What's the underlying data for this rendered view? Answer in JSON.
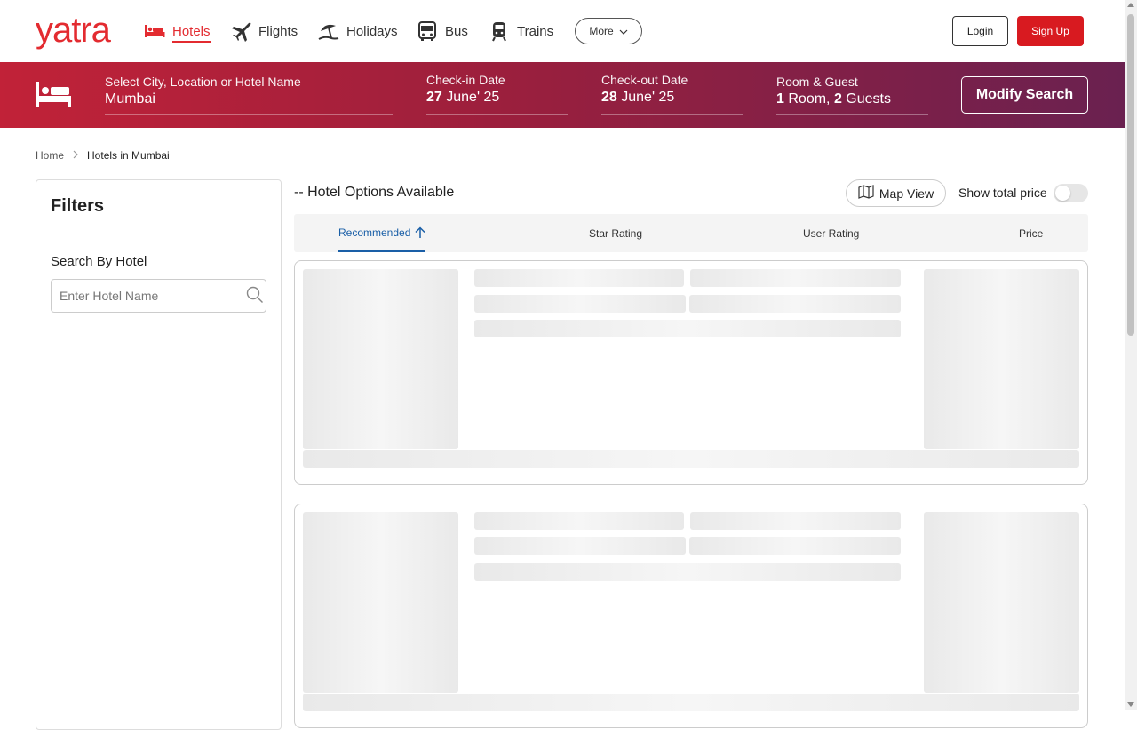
{
  "brand": {
    "logo": "yatra"
  },
  "nav": {
    "items": [
      {
        "label": "Hotels",
        "icon": "hotel-bed-icon",
        "active": true
      },
      {
        "label": "Flights",
        "icon": "plane-icon",
        "active": false
      },
      {
        "label": "Holidays",
        "icon": "beach-umbrella-icon",
        "active": false
      },
      {
        "label": "Bus",
        "icon": "bus-icon",
        "active": false
      },
      {
        "label": "Trains",
        "icon": "train-icon",
        "active": false
      }
    ],
    "more_label": "More",
    "login_label": "Login",
    "signup_label": "Sign Up"
  },
  "search": {
    "city": {
      "label": "Select City, Location or Hotel Name",
      "value": "Mumbai"
    },
    "checkin": {
      "label": "Check-in Date",
      "day": "27",
      "month": "June' 25"
    },
    "checkout": {
      "label": "Check-out Date",
      "day": "28",
      "month": "June' 25"
    },
    "guests": {
      "label": "Room & Guest",
      "rooms": "1",
      "rooms_word": "Room,",
      "guests": "2",
      "guests_word": "Guests"
    },
    "modify_label": "Modify Search"
  },
  "breadcrumb": {
    "home": "Home",
    "current": "Hotels in Mumbai"
  },
  "filters": {
    "title": "Filters",
    "search_by_hotel": "Search By Hotel",
    "hotel_placeholder": "Enter Hotel Name"
  },
  "results": {
    "count_text": "-- Hotel Options Available",
    "map_view_label": "Map View",
    "show_total_price_label": "Show total price",
    "show_total_price_on": false,
    "sort_tabs": [
      "Recommended",
      "Star Rating",
      "User Rating",
      "Price"
    ],
    "active_sort": "Recommended"
  },
  "colors": {
    "brand_red": "#e32b30",
    "accent_blue": "#1a5fa7"
  }
}
